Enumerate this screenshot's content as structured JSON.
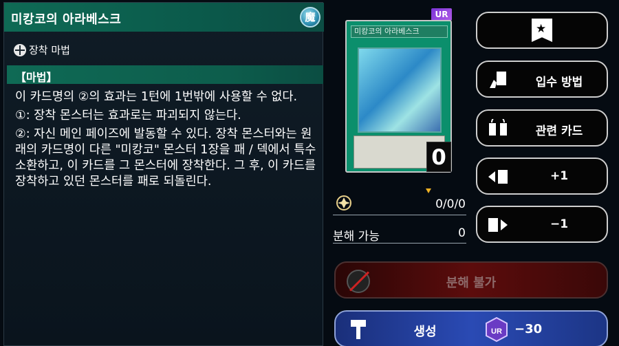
{
  "card": {
    "name": "미캉코의 아라베스크",
    "attribute_icon": "magic-attribute-icon",
    "attribute_glyph": "魔",
    "type": "장착 마법",
    "category": "【마법】",
    "effect": [
      "이 카드명의 ②의 효과는 1턴에 1번밖에 사용할 수 없다.",
      "①: 장착 몬스터는 효과로는 파괴되지 않는다.",
      "②: 자신 메인 페이즈에 발동할 수 있다. 장착 몬스터와는 원래의 카드명이 다른 \"미캉코\" 몬스터 1장을 패 / 덱에서 특수 소환하고, 이 카드를 그 몬스터에 장착한다. 그 후, 이 카드를 장착하고 있던 몬스터를 패로 되돌린다."
    ],
    "image_name": "미캉코의 아라베스크",
    "rarity": "UR",
    "owned": "0"
  },
  "stats": {
    "owned_breakdown": "0/0/0",
    "dismantle_label": "분해 가능",
    "dismantle_count": "0"
  },
  "buttons": {
    "bookmark": "bookmark-icon",
    "acquire": "입수 방법",
    "related": "관련 카드",
    "plus": "+1",
    "minus": "−1",
    "dismantle": "분해 불가",
    "create": "생성",
    "cost": "−30"
  },
  "colors": {
    "title_bar": "#0f6a55",
    "dismantle_bg": "#5c0c0c",
    "create_bg": "#2a4ab4",
    "rarity": "#7a34d6"
  }
}
